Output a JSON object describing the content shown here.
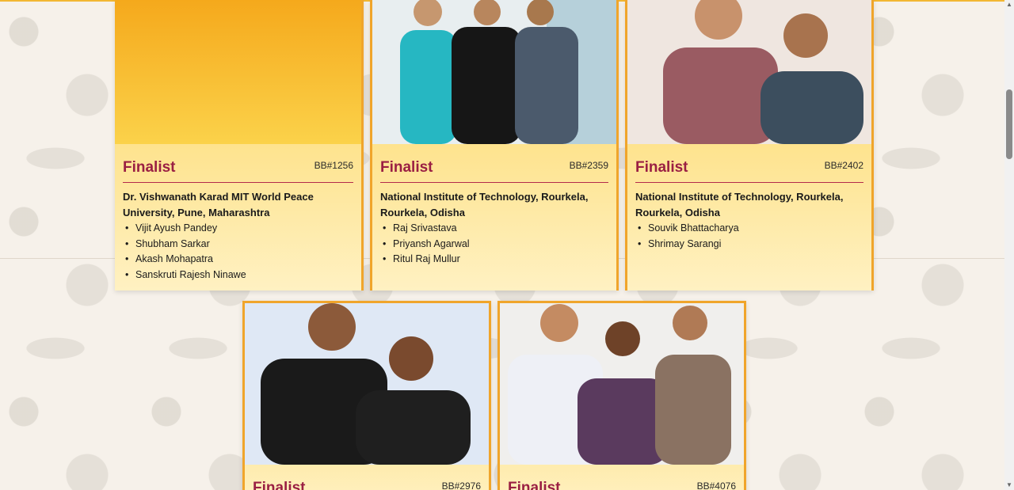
{
  "cards": [
    {
      "status": "Finalist",
      "id": "BB#1256",
      "university": "Dr. Vishwanath Karad MIT World Peace University, Pune, Maharashtra",
      "members": [
        "Vijit Ayush Pandey",
        "Shubham Sarkar",
        "Akash Mohapatra",
        "Sanskruti Rajesh Ninawe"
      ]
    },
    {
      "status": "Finalist",
      "id": "BB#2359",
      "university": "National Institute of Technology, Rourkela, Rourkela, Odisha",
      "members": [
        "Raj Srivastava",
        "Priyansh Agarwal",
        "Ritul Raj Mullur"
      ]
    },
    {
      "status": "Finalist",
      "id": "BB#2402",
      "university": "National Institute of Technology, Rourkela, Rourkela, Odisha",
      "members": [
        "Souvik Bhattacharya",
        "Shrimay Sarangi"
      ]
    },
    {
      "status": "Finalist",
      "id": "BB#2976"
    },
    {
      "status": "Finalist",
      "id": "BB#4076"
    }
  ],
  "colors": {
    "accent": "#9a1f43",
    "border": "#f0a52b",
    "card_top": "#fcd55a",
    "card_bottom": "#fff1c2"
  },
  "icons": {
    "scroll_up": "triangle-up-icon",
    "scroll_down": "triangle-down-icon"
  }
}
